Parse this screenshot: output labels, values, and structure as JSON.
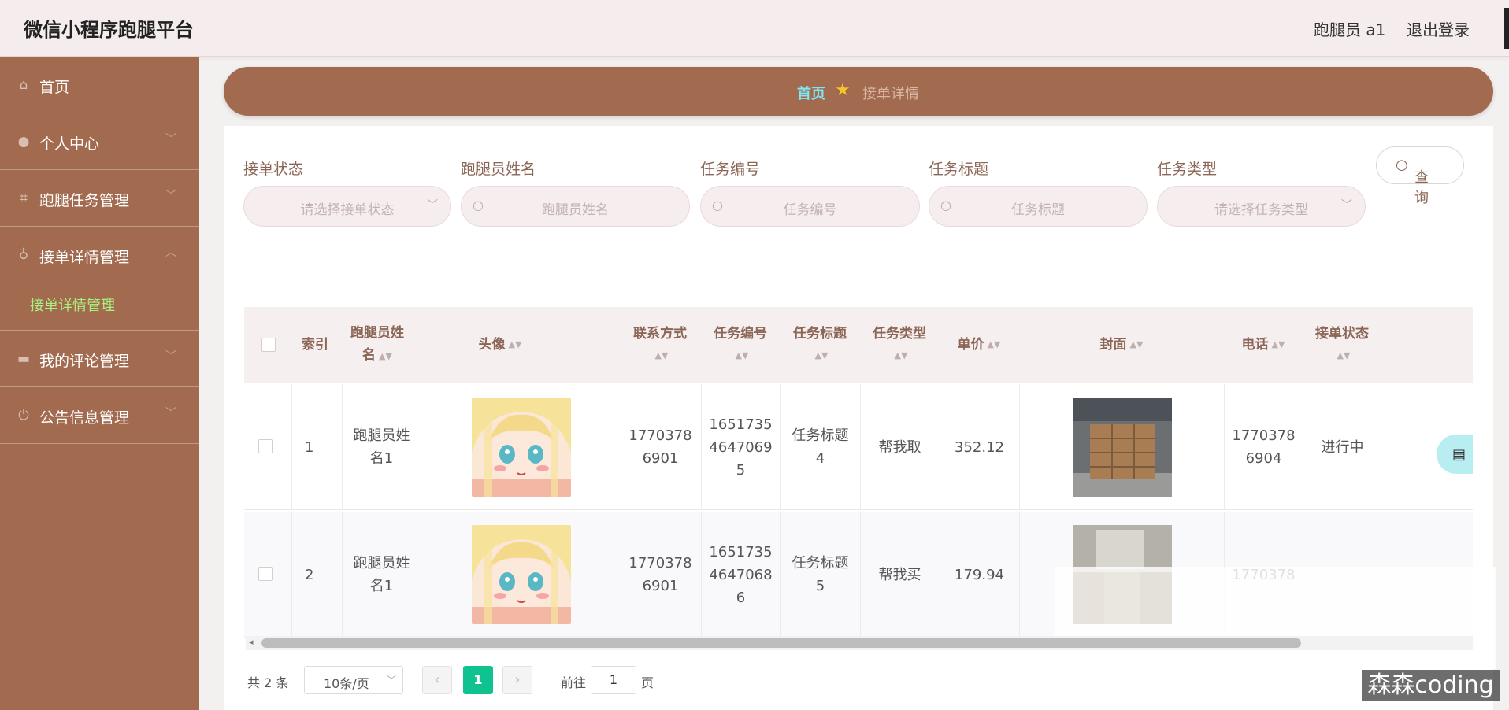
{
  "header": {
    "title": "微信小程序跑腿平台",
    "user": "跑腿员 a1",
    "logout": "退出登录"
  },
  "sidebar": {
    "items": [
      {
        "label": "首页",
        "icon": "home-icon"
      },
      {
        "label": "个人中心",
        "icon": "user-icon"
      },
      {
        "label": "跑腿任务管理",
        "icon": "crop-icon"
      },
      {
        "label": "接单详情管理",
        "icon": "mic-icon"
      },
      {
        "label": "我的评论管理",
        "icon": "card-icon"
      },
      {
        "label": "公告信息管理",
        "icon": "power-icon"
      }
    ],
    "active_sub": "接单详情管理"
  },
  "breadcrumb": {
    "home": "首页",
    "current": "接单详情"
  },
  "filters": {
    "status_label": "接单状态",
    "status_placeholder": "请选择接单状态",
    "runner_label": "跑腿员姓名",
    "runner_placeholder": "跑腿员姓名",
    "task_no_label": "任务编号",
    "task_no_placeholder": "任务编号",
    "task_title_label": "任务标题",
    "task_title_placeholder": "任务标题",
    "task_type_label": "任务类型",
    "task_type_placeholder": "请选择任务类型",
    "query": "查询"
  },
  "table": {
    "headers": {
      "index": "索引",
      "runner_name_1": "跑腿员姓",
      "runner_name_2": "名",
      "avatar": "头像",
      "contact": "联系方式",
      "task_no": "任务编号",
      "task_title": "任务标题",
      "task_type": "任务类型",
      "price": "单价",
      "cover": "封面",
      "phone": "电话",
      "status": "接单状态"
    },
    "rows": [
      {
        "index": "1",
        "runner_1": "跑腿员姓",
        "runner_2": "名1",
        "contact_1": "1770378",
        "contact_2": "6901",
        "task_no_1": "1651735",
        "task_no_2": "4647069",
        "task_no_3": "5",
        "title_1": "任务标题",
        "title_2": "4",
        "type": "帮我取",
        "price": "352.12",
        "phone_1": "1770378",
        "phone_2": "6904",
        "status": "进行中",
        "op_icon": "document-icon"
      },
      {
        "index": "2",
        "runner_1": "跑腿员姓",
        "runner_2": "名1",
        "contact_1": "1770378",
        "contact_2": "6901",
        "task_no_1": "1651735",
        "task_no_2": "4647068",
        "task_no_3": "6",
        "title_1": "任务标题",
        "title_2": "5",
        "type": "帮我买",
        "price": "179.94",
        "phone_1": "1770378",
        "phone_2": "",
        "status": ""
      }
    ]
  },
  "pagination": {
    "total": "共 2 条",
    "page_size": "10条/页",
    "current": "1",
    "goto_prefix": "前往",
    "goto_value": "1",
    "goto_suffix": "页"
  },
  "watermark": "森森coding",
  "colors": {
    "sidebar": "#a26a4e",
    "accent_green": "#0fc28f",
    "active_sub": "#a8f07e",
    "crumb_home": "#7ee8f7"
  }
}
